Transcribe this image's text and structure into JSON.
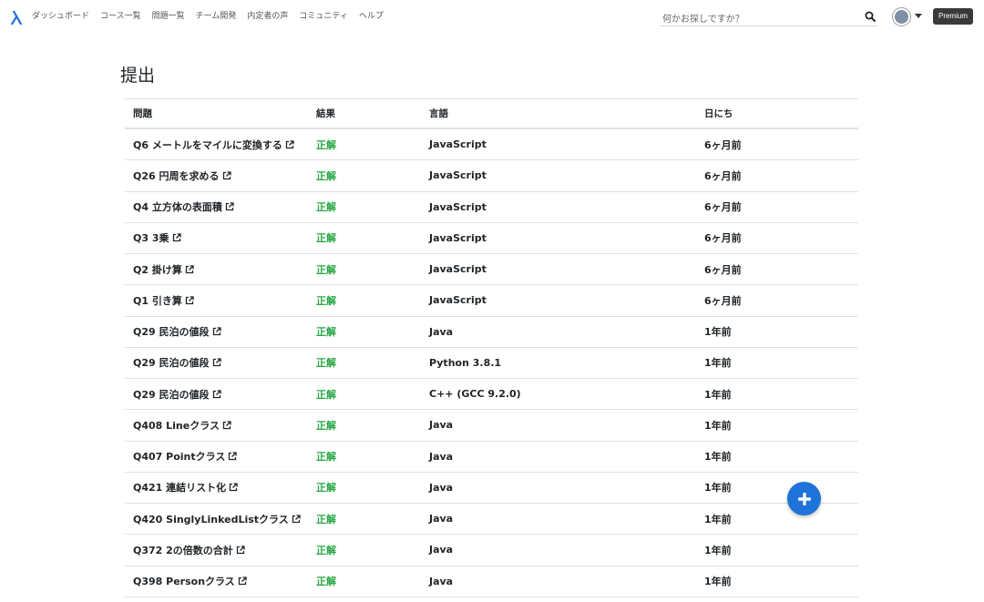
{
  "nav": {
    "items": [
      "ダッシュボード",
      "コース一覧",
      "問題一覧",
      "チーム開発",
      "内定者の声",
      "コミュニティ",
      "ヘルプ"
    ]
  },
  "search": {
    "placeholder": "何かお探しですか？"
  },
  "header": {
    "premium_label": "Premium"
  },
  "page": {
    "title": "提出"
  },
  "table": {
    "headers": [
      "問題",
      "結果",
      "言語",
      "日にち"
    ],
    "rows": [
      {
        "problem": "Q6 メートルをマイルに変換する",
        "result": "正解",
        "language": "JavaScript",
        "date": "6ヶ月前"
      },
      {
        "problem": "Q26 円周を求める",
        "result": "正解",
        "language": "JavaScript",
        "date": "6ヶ月前"
      },
      {
        "problem": "Q4 立方体の表面積",
        "result": "正解",
        "language": "JavaScript",
        "date": "6ヶ月前"
      },
      {
        "problem": "Q3 3乗",
        "result": "正解",
        "language": "JavaScript",
        "date": "6ヶ月前"
      },
      {
        "problem": "Q2 掛け算",
        "result": "正解",
        "language": "JavaScript",
        "date": "6ヶ月前"
      },
      {
        "problem": "Q1 引き算",
        "result": "正解",
        "language": "JavaScript",
        "date": "6ヶ月前"
      },
      {
        "problem": "Q29 民泊の値段",
        "result": "正解",
        "language": "Java",
        "date": "1年前"
      },
      {
        "problem": "Q29 民泊の値段",
        "result": "正解",
        "language": "Python 3.8.1",
        "date": "1年前"
      },
      {
        "problem": "Q29 民泊の値段",
        "result": "正解",
        "language": "C++ (GCC 9.2.0)",
        "date": "1年前"
      },
      {
        "problem": "Q408 Lineクラス",
        "result": "正解",
        "language": "Java",
        "date": "1年前"
      },
      {
        "problem": "Q407 Pointクラス",
        "result": "正解",
        "language": "Java",
        "date": "1年前"
      },
      {
        "problem": "Q421 連結リスト化",
        "result": "正解",
        "language": "Java",
        "date": "1年前"
      },
      {
        "problem": "Q420 SinglyLinkedListクラス",
        "result": "正解",
        "language": "Java",
        "date": "1年前"
      },
      {
        "problem": "Q372 2の倍数の合計",
        "result": "正解",
        "language": "Java",
        "date": "1年前"
      },
      {
        "problem": "Q398 Personクラス",
        "result": "正解",
        "language": "Java",
        "date": "1年前"
      }
    ]
  },
  "icons": {
    "logo": "recursion-logo-icon",
    "search": "search-icon",
    "caret": "chevron-down-icon",
    "external": "external-link-icon",
    "fab": "plus-icon"
  },
  "colors": {
    "accent": "#1f72d8",
    "success": "#28a745",
    "premium_bg": "#3a3a3a"
  }
}
